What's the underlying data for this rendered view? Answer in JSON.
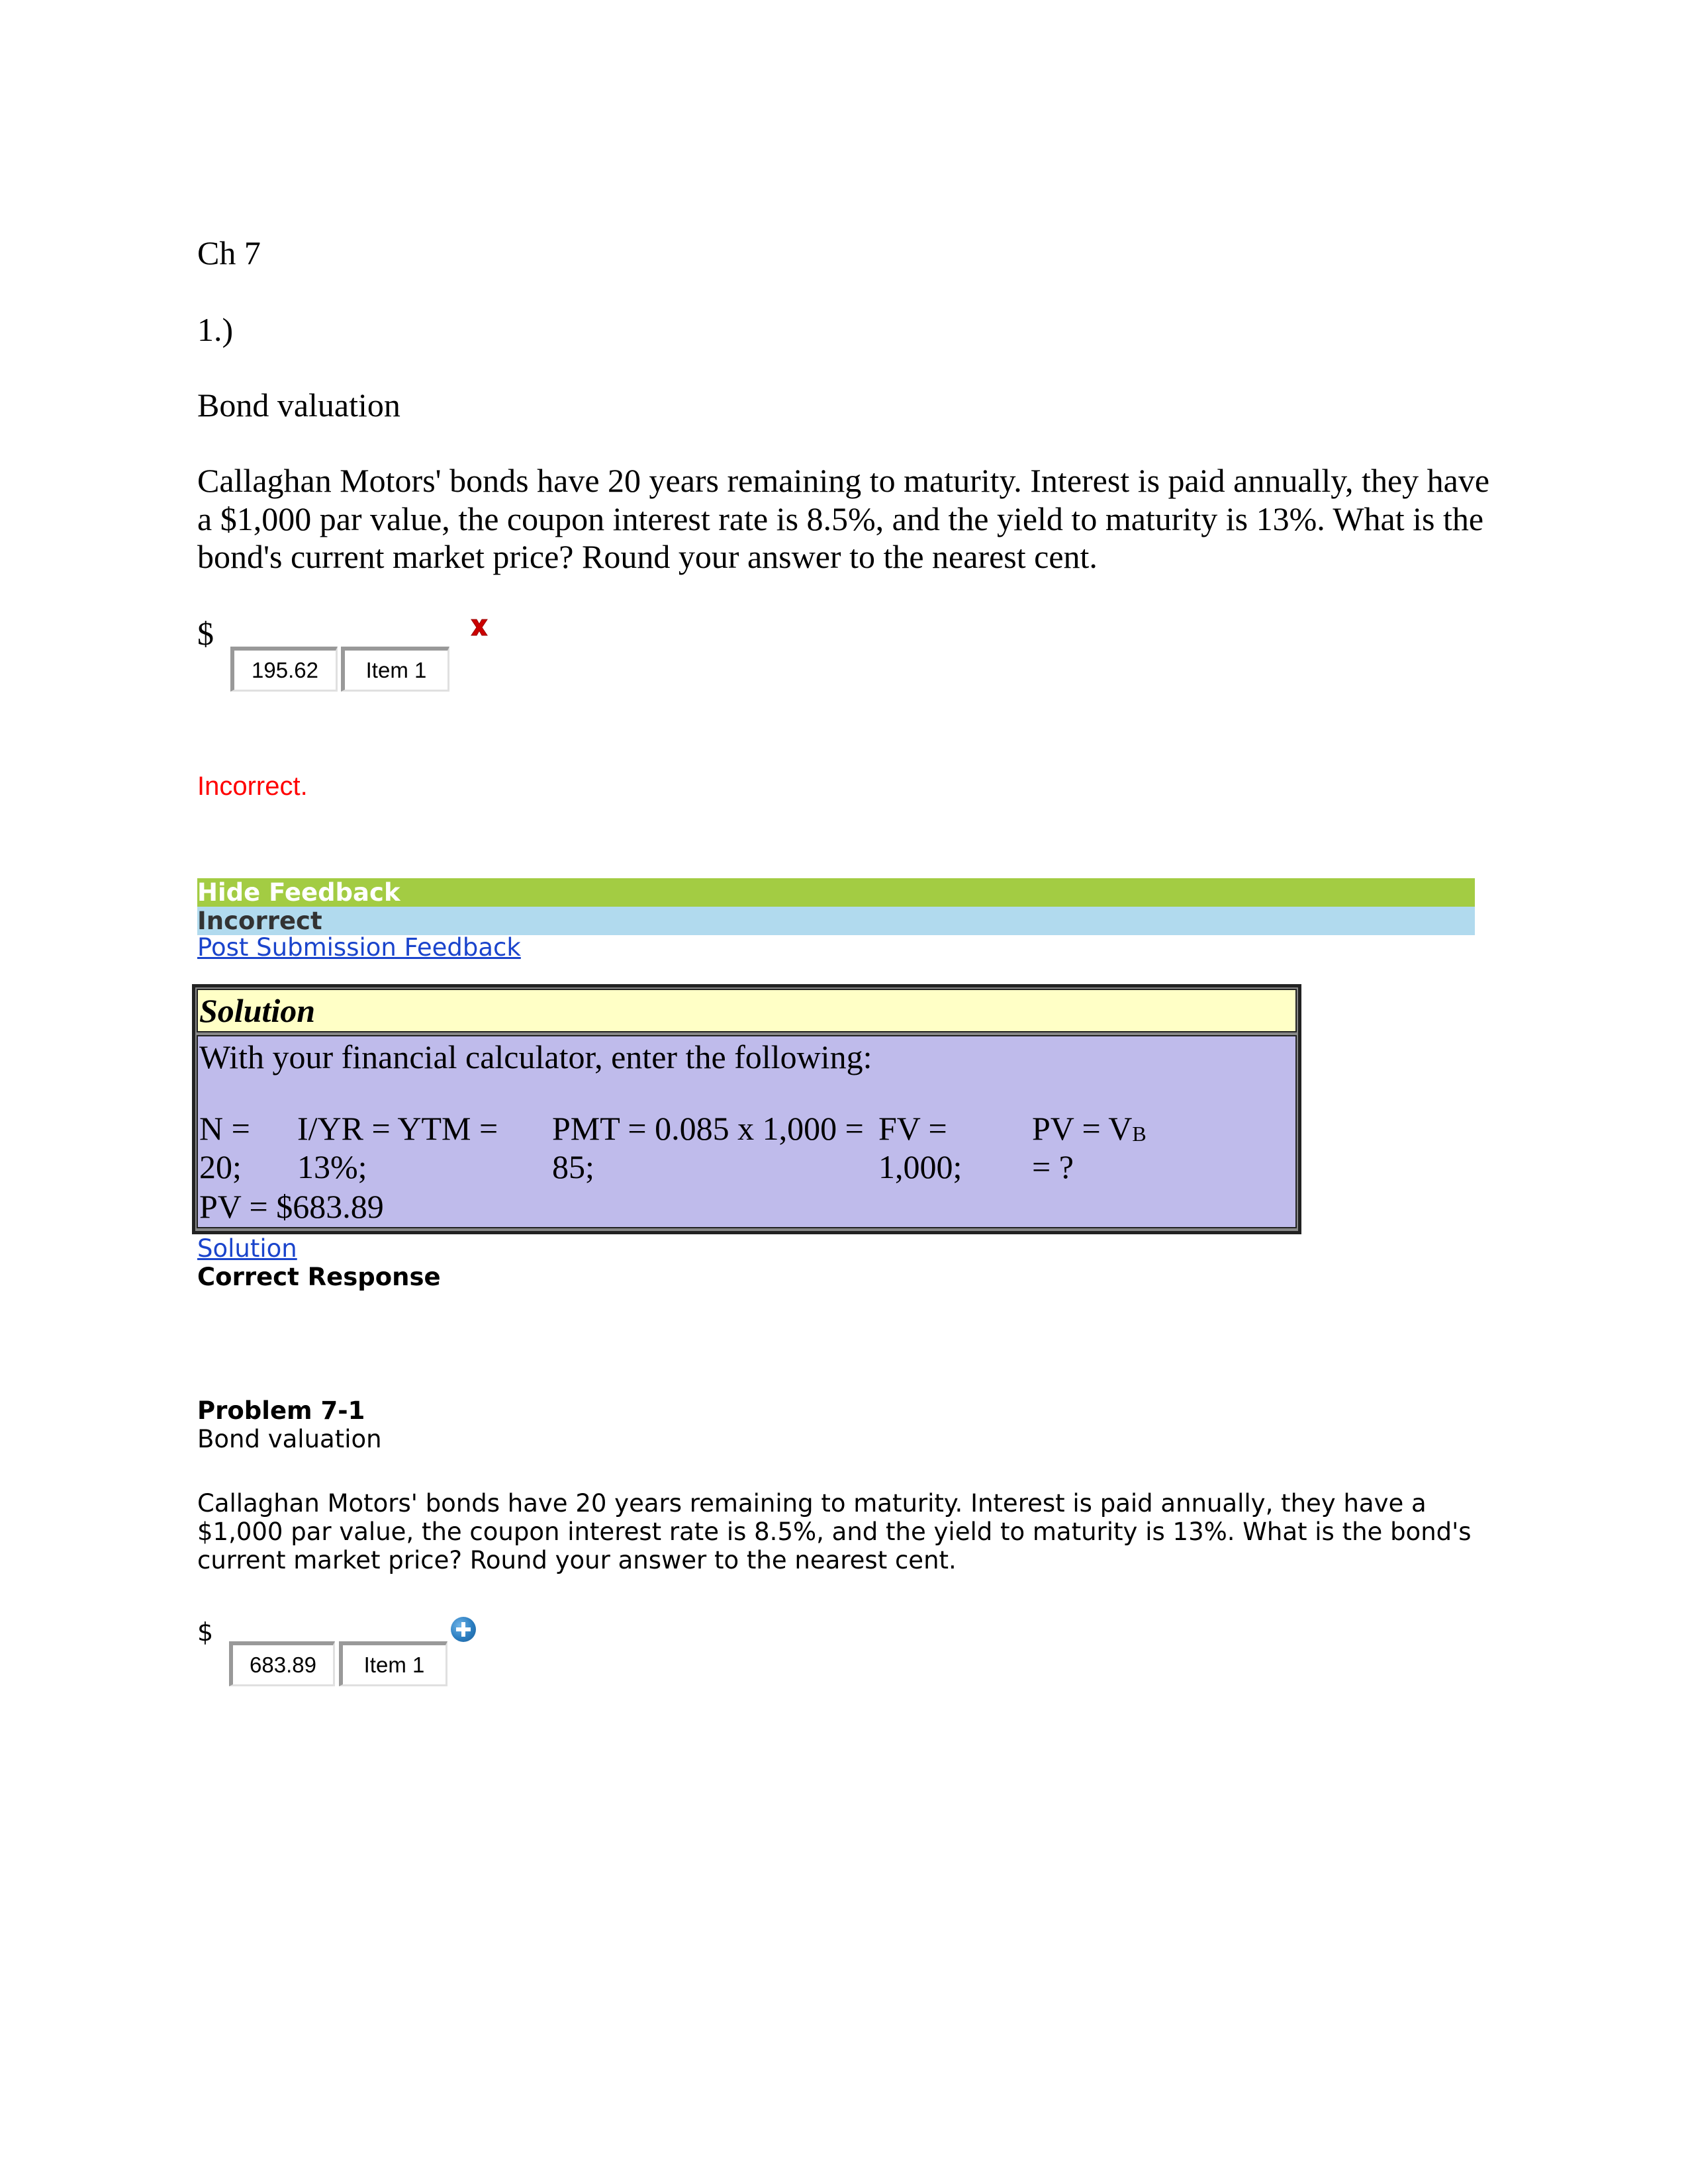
{
  "header": {
    "chapter": "Ch 7",
    "question_number": "1.)",
    "topic": "Bond valuation"
  },
  "question1": {
    "text": "Callaghan Motors' bonds have 20 years remaining to maturity. Interest is paid annually, they have a $1,000 par value, the coupon interest rate is 8.5%, and the yield to maturity is 13%. What is the bond's current market price? Round your answer to the nearest cent.",
    "currency_symbol": "$",
    "answer_value": "195.62",
    "item_label": "Item 1",
    "status_icon": "incorrect-x-icon",
    "result_text": "Incorrect."
  },
  "feedback": {
    "hide_feedback_label": "Hide Feedback",
    "status_label": "Incorrect",
    "post_submission_link": "Post Submission Feedback",
    "colors": {
      "hide_bar": "#a3cc43",
      "status_bar": "#b1daee",
      "link": "#1a44cc",
      "incorrect_text": "#ff0000"
    }
  },
  "solution": {
    "title": "Solution",
    "intro": "With your financial calculator, enter the following:",
    "inputs": [
      {
        "label": "N =",
        "value": "20;"
      },
      {
        "label": "I/YR = YTM =",
        "value": "13%;"
      },
      {
        "label": "PMT = 0.085 x 1,000 =",
        "value": "85;"
      },
      {
        "label": "FV =",
        "value": "1,000;"
      },
      {
        "label": "PV = V",
        "label_sub": "B",
        "value": "= ?"
      }
    ],
    "result": "PV = $683.89",
    "colors": {
      "header_bg": "#ffffc6",
      "body_bg": "#bfbbeb"
    }
  },
  "solution_link": "Solution",
  "correct_response_label": "Correct Response",
  "problem": {
    "title": "Problem 7-1",
    "topic": "Bond valuation",
    "text": "Callaghan Motors' bonds have 20 years remaining to maturity. Interest is paid annually, they have a $1,000 par value, the coupon interest rate is 8.5%, and the yield to maturity is 13%. What is the bond's current market price? Round your answer to the nearest cent.",
    "currency_symbol": "$",
    "answer_value": "683.89",
    "item_label": "Item 1",
    "status_icon": "expand-plus-icon"
  }
}
